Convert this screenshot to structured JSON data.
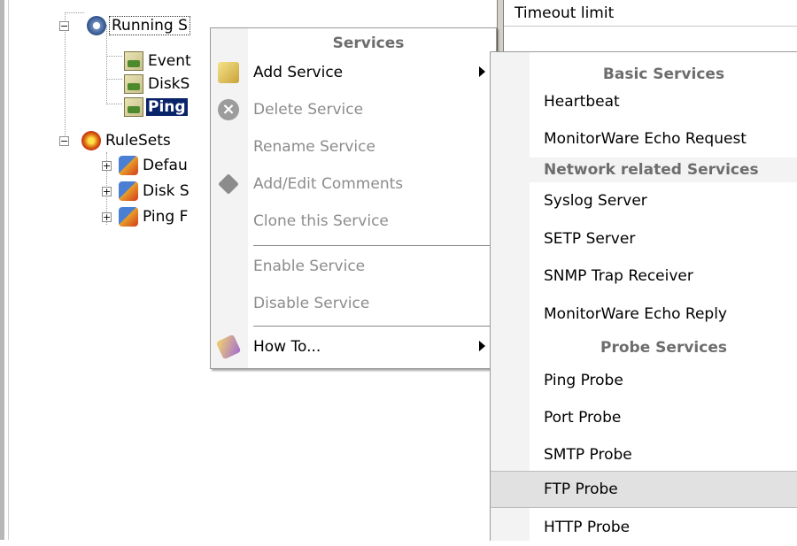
{
  "tree": {
    "running_services": "Running S",
    "services": [
      "Event",
      "DiskS",
      "Ping"
    ],
    "rulesets": "RuleSets",
    "ruleset_items": [
      "Defau",
      "Disk S",
      "Ping F"
    ]
  },
  "grid": {
    "column_header": "Timeout limit"
  },
  "context_menu": {
    "header": "Services",
    "items": [
      {
        "label": "Add Service",
        "enabled": true,
        "icon": "add-service-icon"
      },
      {
        "label": "Delete Service",
        "enabled": false,
        "icon": "delete-icon"
      },
      {
        "label": "Rename Service",
        "enabled": false
      },
      {
        "label": "Add/Edit Comments",
        "enabled": false,
        "icon": "comment-icon"
      },
      {
        "label": "Clone this Service",
        "enabled": false
      },
      {
        "label": "Enable Service",
        "enabled": false
      },
      {
        "label": "Disable Service",
        "enabled": false
      },
      {
        "label": "How To...",
        "enabled": true,
        "icon": "book-icon"
      }
    ]
  },
  "submenu": {
    "group_basic": "Basic Services",
    "basic": [
      "Heartbeat",
      "MonitorWare Echo Request"
    ],
    "group_network": "Network related Services",
    "network": [
      "Syslog Server",
      "SETP Server",
      "SNMP Trap Receiver",
      "MonitorWare Echo Reply"
    ],
    "group_probe": "Probe Services",
    "probe": [
      "Ping Probe",
      "Port Probe",
      "SMTP Probe",
      "FTP Probe",
      "HTTP Probe"
    ],
    "highlighted": "FTP Probe"
  }
}
